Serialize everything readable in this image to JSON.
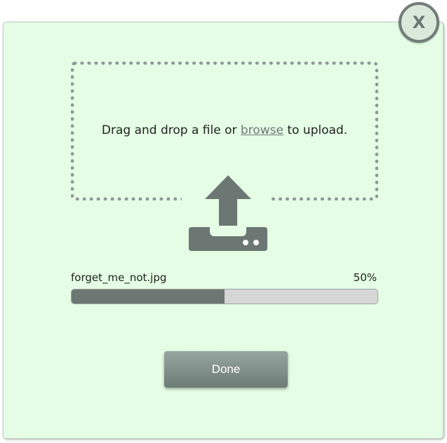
{
  "close_button": {
    "label": "X"
  },
  "dropzone": {
    "text_before": "Drag and drop a file or ",
    "browse_link": "browse",
    "text_after": " to upload.",
    "icon": "upload-icon"
  },
  "upload": {
    "file_name": "forget_me_not.jpg",
    "percent_label": "50%",
    "progress_fraction": 0.5
  },
  "footer": {
    "done_label": "Done"
  },
  "colors": {
    "background": "#e4fde4",
    "accent": "#6c7774",
    "progress_track": "#d6d6d6"
  }
}
